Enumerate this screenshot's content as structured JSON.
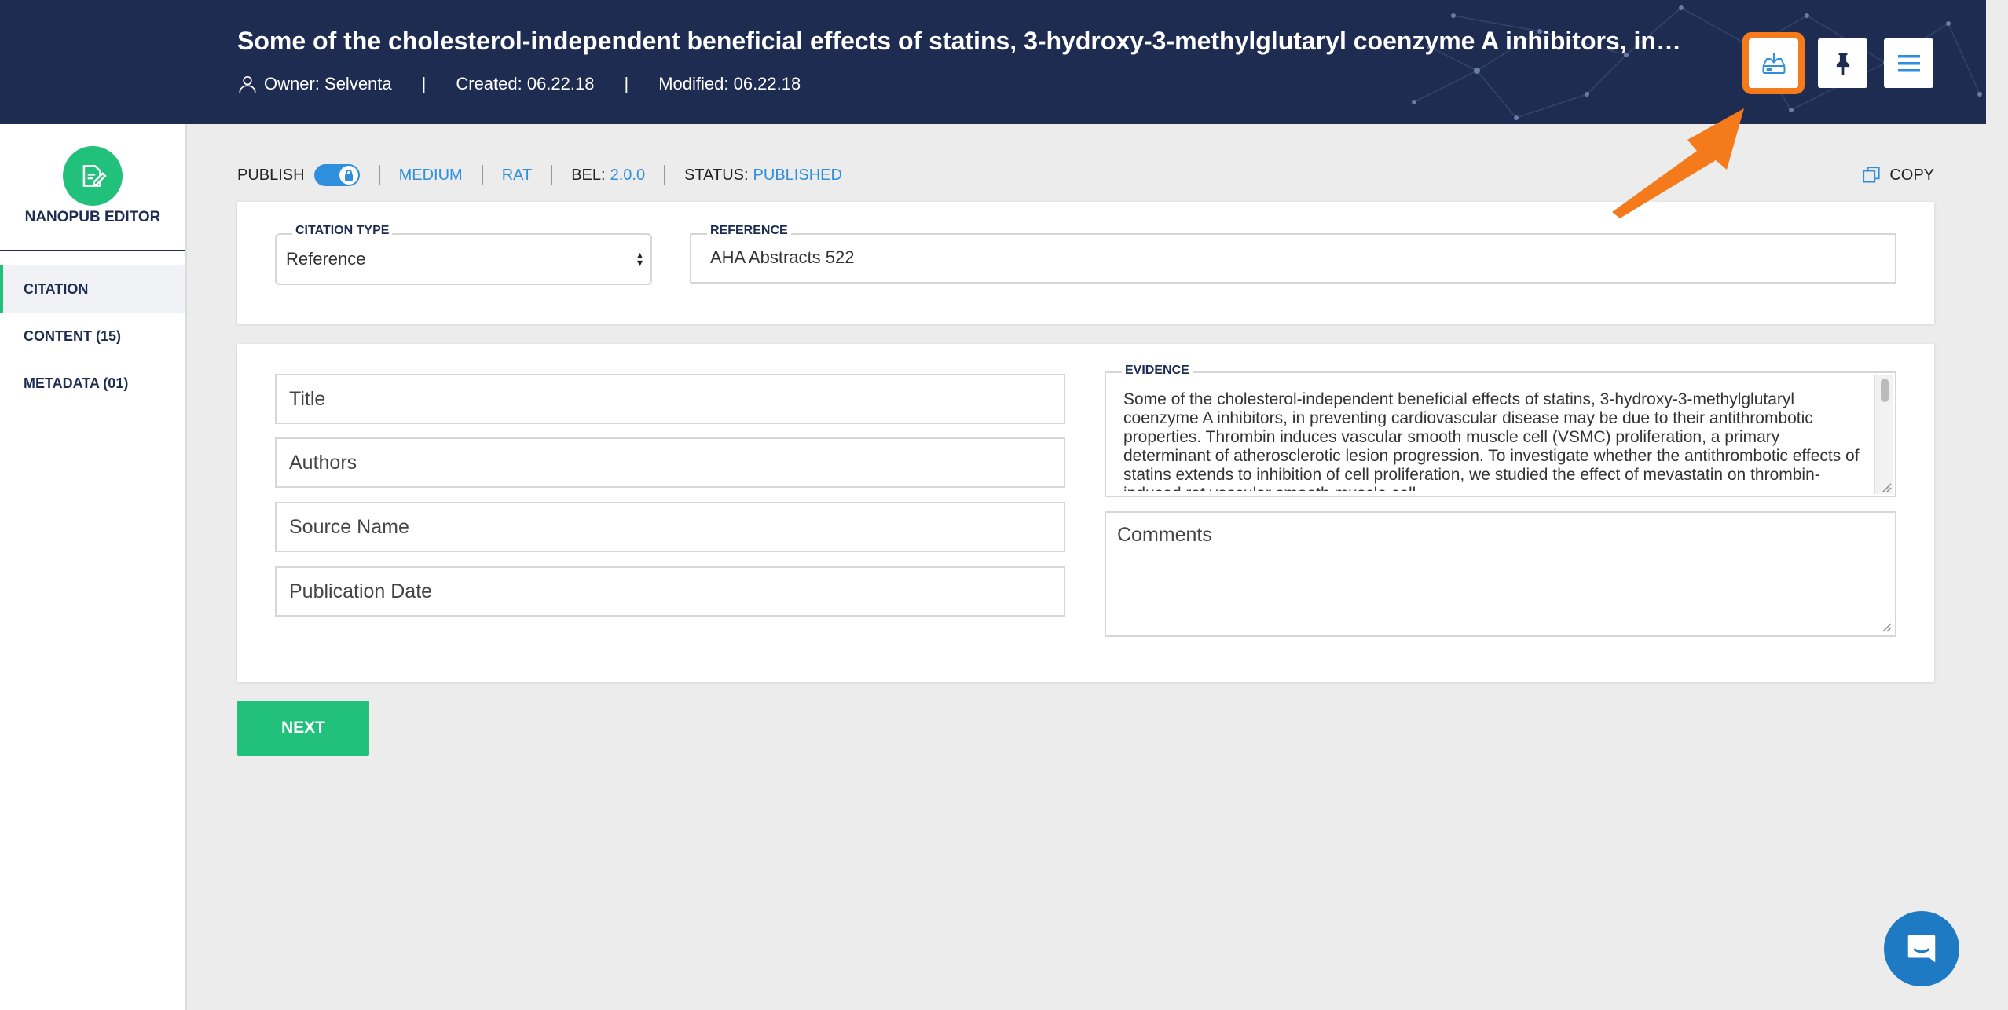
{
  "header": {
    "title": "Some of the cholesterol-independent beneficial effects of statins, 3-hydroxy-3-methylglutaryl coenzyme A inhibitors, in preventi...",
    "owner": "Owner: Selventa",
    "created": "Created: 06.22.18",
    "modified": "Modified: 06.22.18",
    "separator": "|",
    "buttons": {
      "save_icon": "tray-download-icon",
      "pin_icon": "pin-icon",
      "menu_icon": "hamburger-menu-icon"
    },
    "highlight_color": "#f47a1c"
  },
  "sidebar": {
    "title": "NANOPUB EDITOR",
    "items": [
      {
        "label": "CITATION"
      },
      {
        "label": "CONTENT (15)"
      },
      {
        "label": "METADATA (01)"
      }
    ]
  },
  "toolbar": {
    "publish_label": "PUBLISH",
    "medium": "MEDIUM",
    "species": "RAT",
    "bel_label": "BEL:",
    "bel_version": "2.0.0",
    "status_label": "STATUS:",
    "status_value": "PUBLISHED",
    "copy_label": "COPY"
  },
  "citation": {
    "type_label": "CITATION TYPE",
    "type_value": "Reference",
    "reference_label": "REFERENCE",
    "reference_value": "AHA Abstracts 522"
  },
  "form": {
    "title_placeholder": "Title",
    "authors_placeholder": "Authors",
    "source_placeholder": "Source Name",
    "date_placeholder": "Publication Date",
    "evidence_label": "EVIDENCE",
    "evidence_text": "Some of the cholesterol-independent beneficial effects of statins, 3-hydroxy-3-methylglutaryl coenzyme A inhibitors, in preventing cardiovascular disease may be due to their antithrombotic properties. Thrombin induces vascular smooth muscle cell (VSMC) proliferation, a primary determinant of atherosclerotic lesion progression. To investigate whether the antithrombotic effects of statins extends to inhibition of cell proliferation, we studied the effect of mevastatin on thrombin-induced rat vascular smooth muscle cell",
    "comments_placeholder": "Comments"
  },
  "next_label": "NEXT",
  "colors": {
    "navy": "#1f2c52",
    "green": "#21c17b",
    "blue": "#2f8fdd",
    "orange": "#f47a1c"
  }
}
